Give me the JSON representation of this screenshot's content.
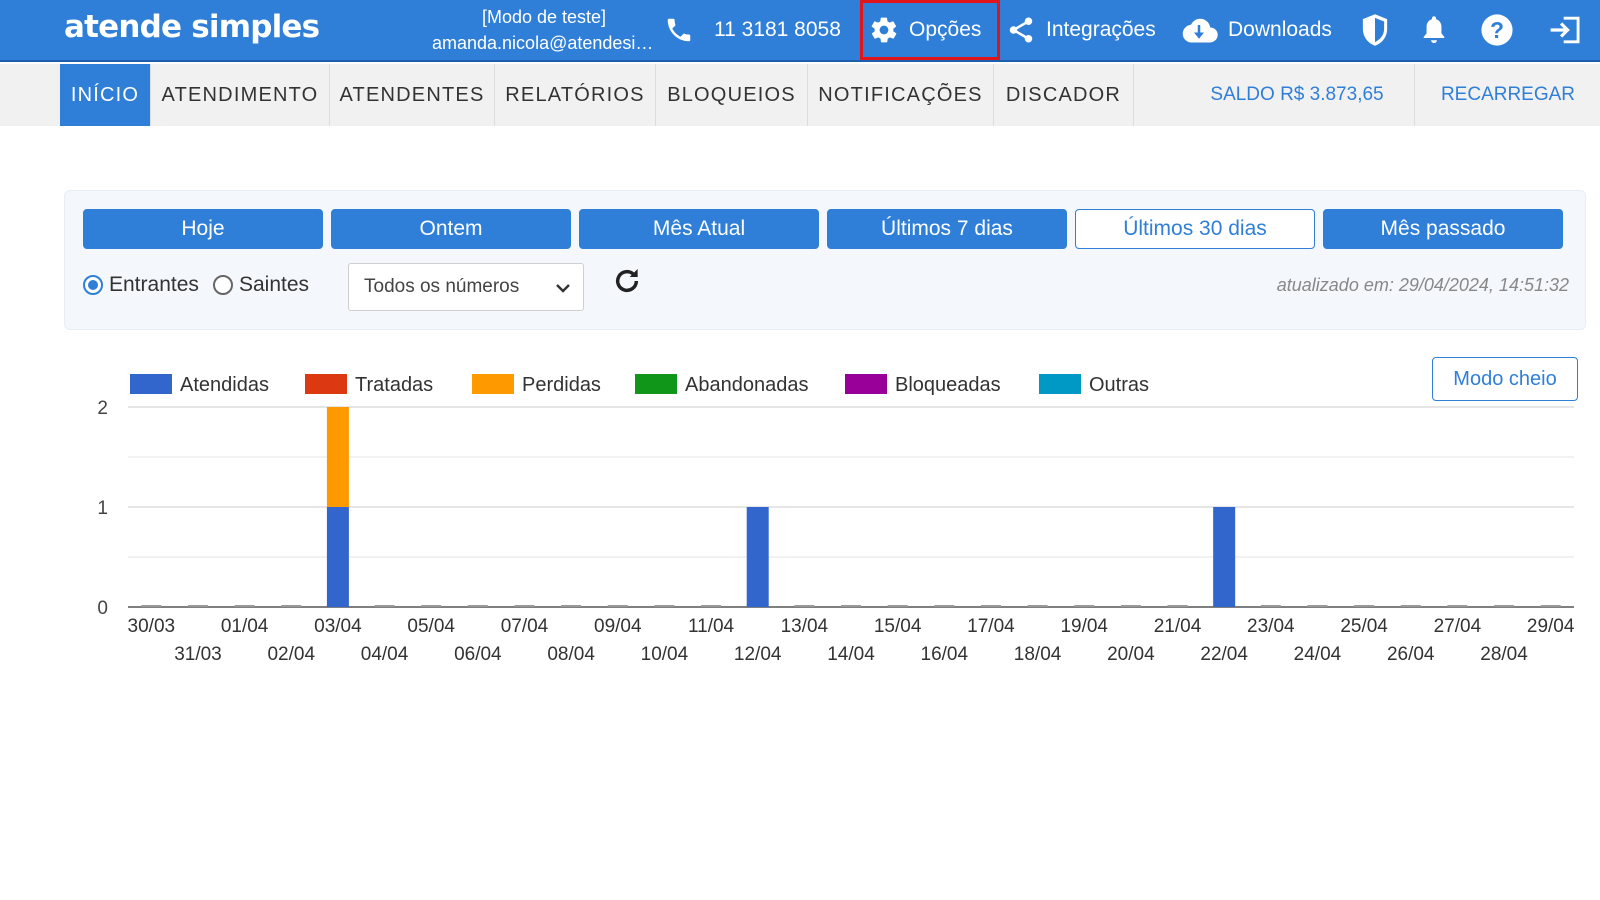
{
  "app": {
    "logo": "atende simples",
    "mode": "[Modo de teste]",
    "email": "amanda.nicola@atendesimples.com"
  },
  "topbar": {
    "phone": "11 3181 8058",
    "options": "Opções",
    "integrations": "Integrações",
    "downloads": "Downloads"
  },
  "nav": {
    "tabs": [
      "INÍCIO",
      "ATENDIMENTO",
      "ATENDENTES",
      "RELATÓRIOS",
      "BLOQUEIOS",
      "NOTIFICAÇÕES",
      "DISCADOR"
    ],
    "active": "INÍCIO",
    "balance": "SALDO R$ 3.873,65",
    "recharge": "RECARREGAR"
  },
  "filters": {
    "periods": [
      "Hoje",
      "Ontem",
      "Mês Atual",
      "Últimos 7 dias",
      "Últimos 30 dias",
      "Mês passado"
    ],
    "selected_period": "Últimos 30 dias",
    "direction_options": [
      "Entrantes",
      "Saintes"
    ],
    "selected_direction": "Entrantes",
    "number_select": "Todos os números",
    "updated": "atualizado em: 29/04/2024, 14:51:32"
  },
  "chart_actions": {
    "full_mode": "Modo cheio"
  },
  "colors": {
    "primary": "#2f7fd8",
    "highlight": "#e0151b"
  },
  "icons": [
    "phone-icon",
    "gear-icon",
    "share-icon",
    "cloud-download-icon",
    "shield-icon",
    "bell-icon",
    "help-icon",
    "logout-icon",
    "refresh-icon",
    "chevron-down-icon"
  ],
  "chart_data": {
    "type": "bar",
    "stacked": true,
    "categories": [
      "30/03",
      "31/03",
      "01/04",
      "02/04",
      "03/04",
      "04/04",
      "05/04",
      "06/04",
      "07/04",
      "08/04",
      "09/04",
      "10/04",
      "11/04",
      "12/04",
      "13/04",
      "14/04",
      "15/04",
      "16/04",
      "17/04",
      "18/04",
      "19/04",
      "20/04",
      "21/04",
      "22/04",
      "23/04",
      "24/04",
      "25/04",
      "26/04",
      "27/04",
      "28/04",
      "29/04"
    ],
    "series": [
      {
        "name": "Atendidas",
        "color": "#3366cc",
        "values": [
          0,
          0,
          0,
          0,
          1,
          0,
          0,
          0,
          0,
          0,
          0,
          0,
          0,
          1,
          0,
          0,
          0,
          0,
          0,
          0,
          0,
          0,
          0,
          1,
          0,
          0,
          0,
          0,
          0,
          0,
          0
        ]
      },
      {
        "name": "Tratadas",
        "color": "#dc3912",
        "values": [
          0,
          0,
          0,
          0,
          0,
          0,
          0,
          0,
          0,
          0,
          0,
          0,
          0,
          0,
          0,
          0,
          0,
          0,
          0,
          0,
          0,
          0,
          0,
          0,
          0,
          0,
          0,
          0,
          0,
          0,
          0
        ]
      },
      {
        "name": "Perdidas",
        "color": "#ff9900",
        "values": [
          0,
          0,
          0,
          0,
          1,
          0,
          0,
          0,
          0,
          0,
          0,
          0,
          0,
          0,
          0,
          0,
          0,
          0,
          0,
          0,
          0,
          0,
          0,
          0,
          0,
          0,
          0,
          0,
          0,
          0,
          0
        ]
      },
      {
        "name": "Abandonadas",
        "color": "#109618",
        "values": [
          0,
          0,
          0,
          0,
          0,
          0,
          0,
          0,
          0,
          0,
          0,
          0,
          0,
          0,
          0,
          0,
          0,
          0,
          0,
          0,
          0,
          0,
          0,
          0,
          0,
          0,
          0,
          0,
          0,
          0,
          0
        ]
      },
      {
        "name": "Bloqueadas",
        "color": "#990099",
        "values": [
          0,
          0,
          0,
          0,
          0,
          0,
          0,
          0,
          0,
          0,
          0,
          0,
          0,
          0,
          0,
          0,
          0,
          0,
          0,
          0,
          0,
          0,
          0,
          0,
          0,
          0,
          0,
          0,
          0,
          0,
          0
        ]
      },
      {
        "name": "Outras",
        "color": "#0099c6",
        "values": [
          0,
          0,
          0,
          0,
          0,
          0,
          0,
          0,
          0,
          0,
          0,
          0,
          0,
          0,
          0,
          0,
          0,
          0,
          0,
          0,
          0,
          0,
          0,
          0,
          0,
          0,
          0,
          0,
          0,
          0,
          0
        ]
      }
    ],
    "ylim": [
      0,
      2
    ],
    "yticks": [
      0,
      1,
      2
    ],
    "grid": true,
    "legend": "top-left"
  }
}
